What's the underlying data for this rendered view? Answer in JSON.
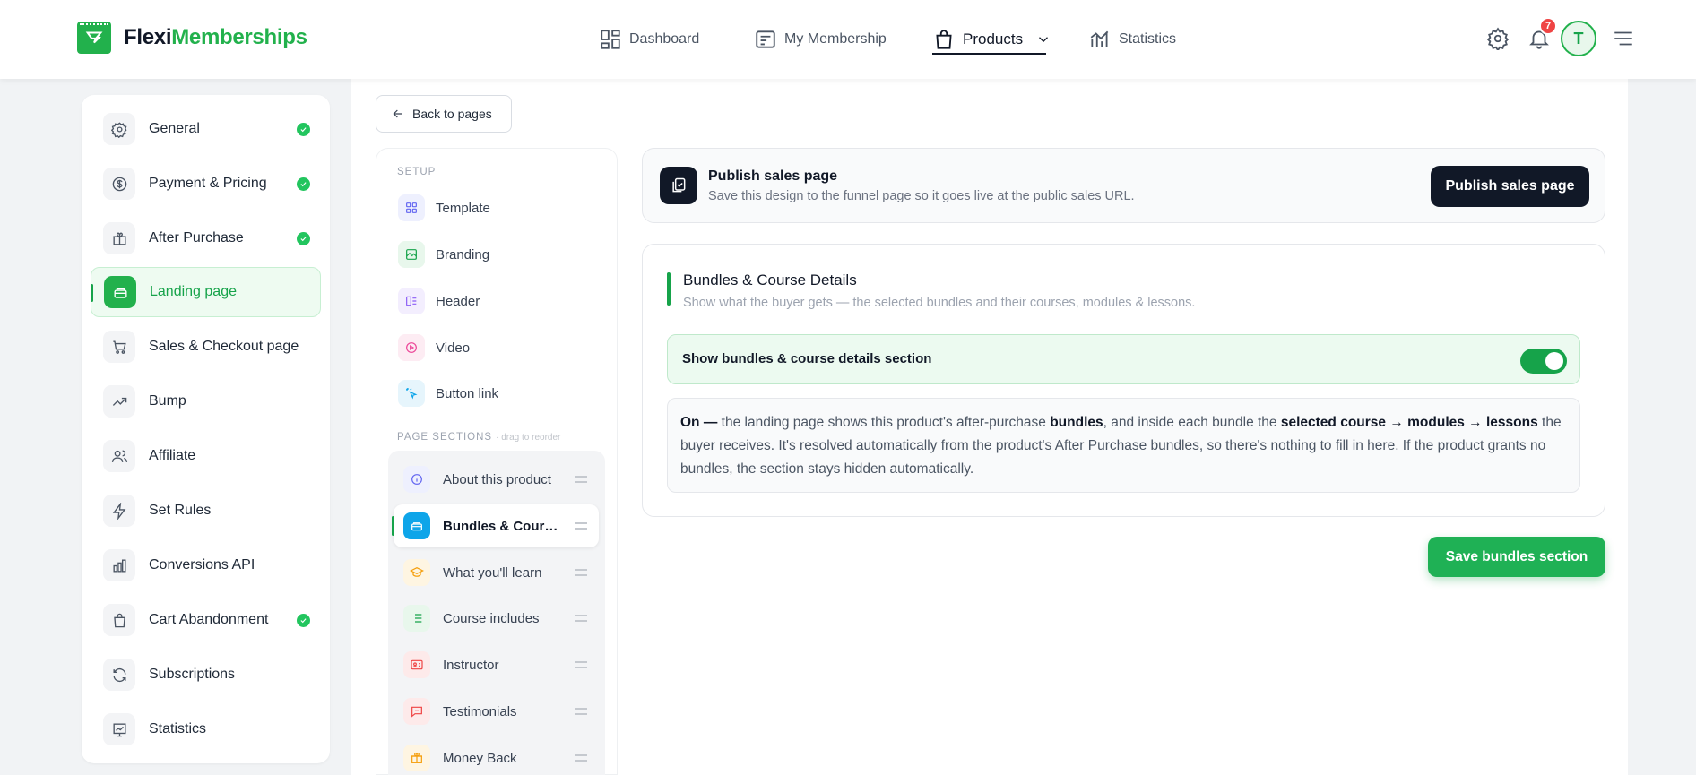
{
  "app": {
    "brand_part1": "Flexi",
    "brand_part2": "Memberships",
    "brand_color": "#22b14c"
  },
  "topnav": {
    "items": [
      {
        "label": "Dashboard",
        "icon": "dashboard-icon"
      },
      {
        "label": "My Membership",
        "icon": "membership-icon"
      },
      {
        "label": "Products",
        "icon": "shopping-bag-icon",
        "active": true
      },
      {
        "label": "Statistics",
        "icon": "bar-chart-icon"
      }
    ],
    "notifications_count": "7",
    "avatar_initial": "T"
  },
  "sidebar": {
    "items": [
      {
        "label": "General",
        "icon": "gear-icon",
        "complete": true
      },
      {
        "label": "Payment & Pricing",
        "icon": "dollar-icon",
        "complete": true
      },
      {
        "label": "After Purchase",
        "icon": "gift-icon",
        "complete": true
      },
      {
        "label": "Landing page",
        "icon": "landing-icon",
        "active": true
      },
      {
        "label": "Sales & Checkout page",
        "icon": "cart-icon"
      },
      {
        "label": "Bump",
        "icon": "trend-up-icon"
      },
      {
        "label": "Affiliate",
        "icon": "users-icon"
      },
      {
        "label": "Set Rules",
        "icon": "bolt-icon"
      },
      {
        "label": "Conversions API",
        "icon": "bars-icon"
      },
      {
        "label": "Cart Abandonment",
        "icon": "bag-icon",
        "complete": true
      },
      {
        "label": "Subscriptions",
        "icon": "refresh-icon"
      },
      {
        "label": "Statistics",
        "icon": "chart-icon"
      }
    ]
  },
  "back_button": "Back to pages",
  "subnav": {
    "setup_label": "SETUP",
    "setup_items": [
      {
        "label": "Template",
        "icon": "grid-icon",
        "color": "#6366f1"
      },
      {
        "label": "Branding",
        "icon": "palette-icon",
        "color": "#16a34a"
      },
      {
        "label": "Header",
        "icon": "header-icon",
        "color": "#8b5cf6"
      },
      {
        "label": "Video",
        "icon": "play-icon",
        "color": "#ec4899"
      },
      {
        "label": "Button link",
        "icon": "pointer-icon",
        "color": "#0ea5e9"
      }
    ],
    "sections_label": "PAGE SECTIONS",
    "sections_hint": "· drag to reorder",
    "sections": [
      {
        "label": "About this product",
        "icon": "info-icon",
        "color": "#6366f1"
      },
      {
        "label": "Bundles & Course Details",
        "icon": "box-icon",
        "color": "#0ea5e9",
        "active": true
      },
      {
        "label": "What you'll learn",
        "icon": "graduation-icon",
        "color": "#f59e0b"
      },
      {
        "label": "Course includes",
        "icon": "list-icon",
        "color": "#16a34a"
      },
      {
        "label": "Instructor",
        "icon": "id-card-icon",
        "color": "#ef4444"
      },
      {
        "label": "Testimonials",
        "icon": "chat-icon",
        "color": "#ef4444"
      },
      {
        "label": "Money Back",
        "icon": "gift-icon",
        "color": "#f59e0b"
      }
    ]
  },
  "publish": {
    "title": "Publish sales page",
    "subtitle": "Save this design to the funnel page so it goes live at the public sales URL.",
    "button": "Publish sales page"
  },
  "details": {
    "title": "Bundles & Course Details",
    "subtitle": "Show what the buyer gets — the selected bundles and their courses, modules & lessons.",
    "toggle_label": "Show bundles & course details section",
    "toggle_on": true,
    "info": {
      "on": "On —",
      "t1": " the landing page shows this product's after-purchase ",
      "bundles": "bundles",
      "t2": ", and inside each bundle the ",
      "path": "selected course → modules → lessons",
      "t3": " the buyer receives. It's resolved automatically from the product's After Purchase bundles, so there's nothing to fill in here. If the product grants no bundles, the section stays hidden automatically."
    }
  },
  "save_button": "Save bundles section"
}
